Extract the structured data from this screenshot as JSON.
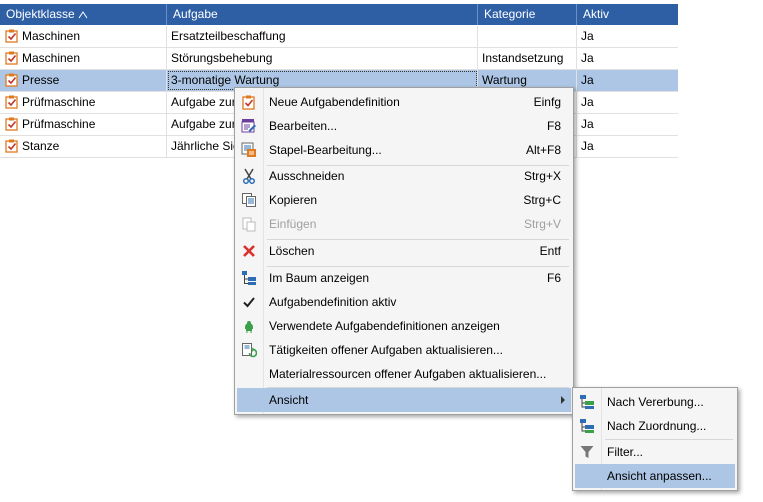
{
  "columns": [
    "Objektklasse",
    "Aufgabe",
    "Kategorie",
    "Aktiv"
  ],
  "rows": [
    {
      "klasse": "Maschinen",
      "aufgabe": "Ersatzteilbeschaffung",
      "kategorie": "",
      "aktiv": "Ja"
    },
    {
      "klasse": "Maschinen",
      "aufgabe": "Störungsbehebung",
      "kategorie": "Instandsetzung",
      "aktiv": "Ja"
    },
    {
      "klasse": "Presse",
      "aufgabe": "3-monatige Wartung",
      "kategorie": "Wartung",
      "aktiv": "Ja"
    },
    {
      "klasse": "Prüfmaschine",
      "aufgabe": "Aufgabe zur",
      "kategorie": "",
      "aktiv": "Ja"
    },
    {
      "klasse": "Prüfmaschine",
      "aufgabe": "Aufgabe zur",
      "kategorie": "",
      "aktiv": "Ja"
    },
    {
      "klasse": "Stanze",
      "aufgabe": "Jährliche Sic",
      "kategorie": "",
      "aktiv": "Ja"
    }
  ],
  "context_menu": {
    "items": [
      {
        "label": "Neue Aufgabendefinition",
        "shortcut": "Einfg"
      },
      {
        "label": "Bearbeiten...",
        "shortcut": "F8"
      },
      {
        "label": "Stapel-Bearbeitung...",
        "shortcut": "Alt+F8"
      },
      {
        "label": "Ausschneiden",
        "shortcut": "Strg+X"
      },
      {
        "label": "Kopieren",
        "shortcut": "Strg+C"
      },
      {
        "label": "Einfügen",
        "shortcut": "Strg+V"
      },
      {
        "label": "Löschen",
        "shortcut": "Entf"
      },
      {
        "label": "Im Baum anzeigen",
        "shortcut": "F6"
      },
      {
        "label": "Aufgabendefinition aktiv",
        "shortcut": ""
      },
      {
        "label": "Verwendete Aufgabendefinitionen anzeigen",
        "shortcut": ""
      },
      {
        "label": "Tätigkeiten offener Aufgaben aktualisieren...",
        "shortcut": ""
      },
      {
        "label": "Materialressourcen offener Aufgaben aktualisieren...",
        "shortcut": ""
      },
      {
        "label": "Ansicht",
        "shortcut": ""
      }
    ]
  },
  "submenu": {
    "items": [
      {
        "label": "Nach Vererbung..."
      },
      {
        "label": "Nach Zuordnung..."
      },
      {
        "label": "Filter..."
      },
      {
        "label": "Ansicht anpassen..."
      }
    ]
  },
  "icons": {
    "row": "task-checkbox-icon",
    "new": "new-task-icon",
    "edit": "edit-icon",
    "batch": "batch-edit-icon",
    "cut": "scissors-icon",
    "copy": "copy-icon",
    "paste": "paste-icon",
    "delete": "delete-x-icon",
    "tree": "tree-view-icon",
    "check": "checkmark-icon",
    "used": "used-definitions-icon",
    "refresh": "refresh-tasks-icon",
    "filter": "filter-icon"
  },
  "colors": {
    "header_bg": "#2e5fa5",
    "selection": "#adc6e5",
    "delete_red": "#d9312b",
    "check_orange": "#e07a1f"
  }
}
